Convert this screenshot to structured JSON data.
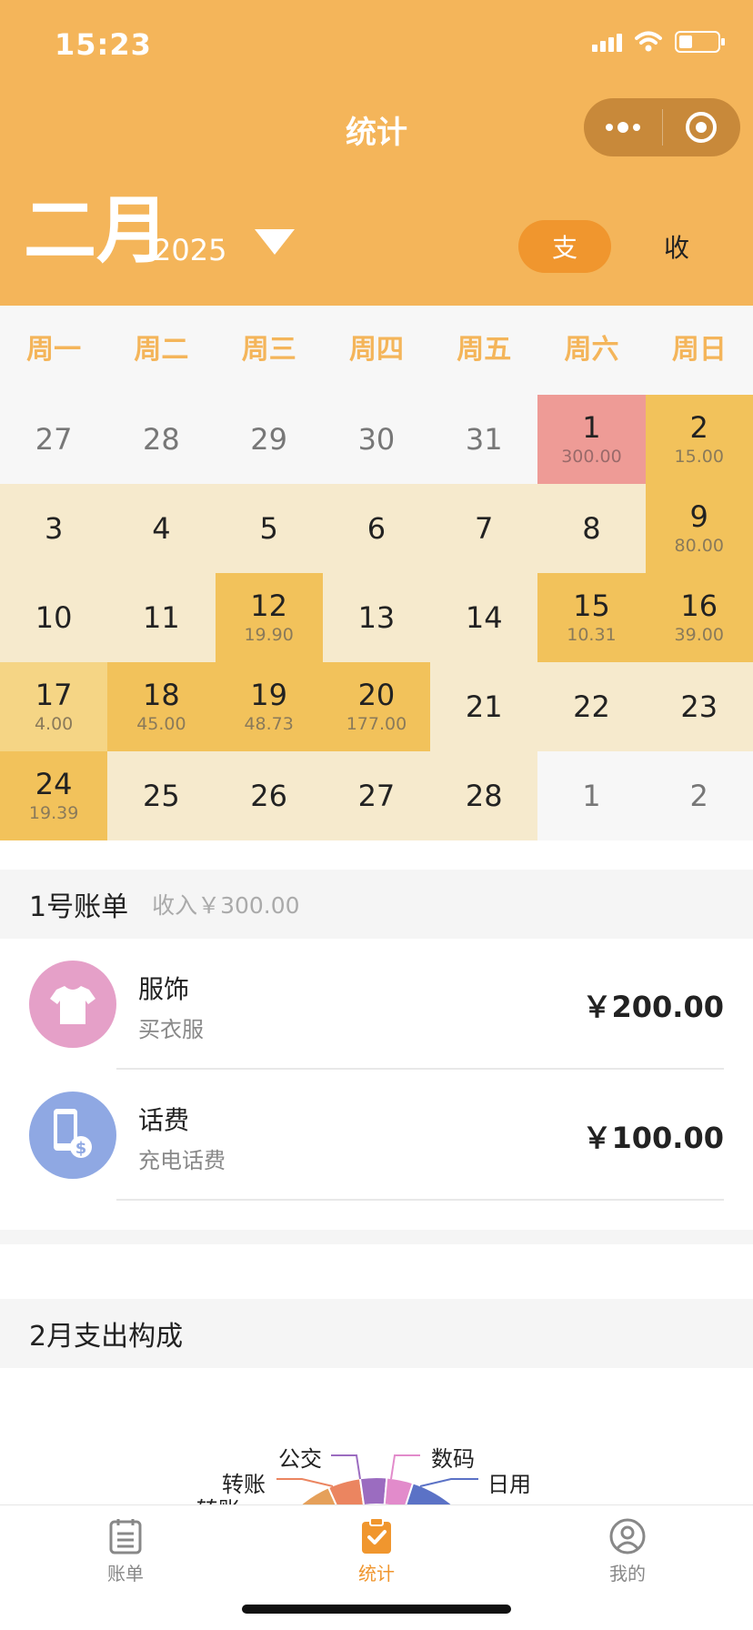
{
  "status": {
    "time": "15:23"
  },
  "nav": {
    "title": "统计"
  },
  "header": {
    "month": "二月",
    "year": "2025",
    "expense_label": "支",
    "income_label": "收"
  },
  "calendar": {
    "weekdays": [
      "周一",
      "周二",
      "周三",
      "周四",
      "周五",
      "周六",
      "周日"
    ],
    "rows": [
      [
        {
          "day": "27",
          "amount": "",
          "kind": "other"
        },
        {
          "day": "28",
          "amount": "",
          "kind": "other"
        },
        {
          "day": "29",
          "amount": "",
          "kind": "other"
        },
        {
          "day": "30",
          "amount": "",
          "kind": "other"
        },
        {
          "day": "31",
          "amount": "",
          "kind": "other"
        },
        {
          "day": "1",
          "amount": "300.00",
          "kind": "inc"
        },
        {
          "day": "2",
          "amount": "15.00",
          "kind": "exp"
        }
      ],
      [
        {
          "day": "3",
          "amount": "",
          "kind": "normal"
        },
        {
          "day": "4",
          "amount": "",
          "kind": "normal"
        },
        {
          "day": "5",
          "amount": "",
          "kind": "normal"
        },
        {
          "day": "6",
          "amount": "",
          "kind": "normal"
        },
        {
          "day": "7",
          "amount": "",
          "kind": "normal"
        },
        {
          "day": "8",
          "amount": "",
          "kind": "normal"
        },
        {
          "day": "9",
          "amount": "80.00",
          "kind": "exp"
        }
      ],
      [
        {
          "day": "10",
          "amount": "",
          "kind": "normal"
        },
        {
          "day": "11",
          "amount": "",
          "kind": "normal"
        },
        {
          "day": "12",
          "amount": "19.90",
          "kind": "exp"
        },
        {
          "day": "13",
          "amount": "",
          "kind": "normal"
        },
        {
          "day": "14",
          "amount": "",
          "kind": "normal"
        },
        {
          "day": "15",
          "amount": "10.31",
          "kind": "exp"
        },
        {
          "day": "16",
          "amount": "39.00",
          "kind": "exp"
        }
      ],
      [
        {
          "day": "17",
          "amount": "4.00",
          "kind": "light"
        },
        {
          "day": "18",
          "amount": "45.00",
          "kind": "exp"
        },
        {
          "day": "19",
          "amount": "48.73",
          "kind": "exp"
        },
        {
          "day": "20",
          "amount": "177.00",
          "kind": "exp"
        },
        {
          "day": "21",
          "amount": "",
          "kind": "normal"
        },
        {
          "day": "22",
          "amount": "",
          "kind": "normal"
        },
        {
          "day": "23",
          "amount": "",
          "kind": "normal"
        }
      ],
      [
        {
          "day": "24",
          "amount": "19.39",
          "kind": "exp"
        },
        {
          "day": "25",
          "amount": "",
          "kind": "normal"
        },
        {
          "day": "26",
          "amount": "",
          "kind": "normal"
        },
        {
          "day": "27",
          "amount": "",
          "kind": "normal"
        },
        {
          "day": "28",
          "amount": "",
          "kind": "normal"
        },
        {
          "day": "1",
          "amount": "",
          "kind": "other"
        },
        {
          "day": "2",
          "amount": "",
          "kind": "other"
        }
      ]
    ]
  },
  "bill": {
    "title": "1号账单",
    "income": "收入￥300.00",
    "items": [
      {
        "name": "服饰",
        "note": "买衣服",
        "amount": "￥200.00",
        "icon": "tshirt-icon",
        "color": "#E5A0C8"
      },
      {
        "name": "话费",
        "note": "充电话费",
        "amount": "￥100.00",
        "icon": "phone-bill-icon",
        "color": "#8FA8E3"
      }
    ]
  },
  "composition": {
    "title": "2月支出构成"
  },
  "chart_data": {
    "type": "pie",
    "labels": [
      "公交",
      "数码",
      "转账",
      "日用",
      "转账"
    ],
    "colors": [
      "#9B6CC0",
      "#E28BCB",
      "#EB8560",
      "#5B72C6",
      "#E5A05A"
    ]
  },
  "tabs": [
    {
      "label": "账单",
      "icon": "bill-list-icon",
      "active": false
    },
    {
      "label": "统计",
      "icon": "stats-clipboard-icon",
      "active": true
    },
    {
      "label": "我的",
      "icon": "profile-icon",
      "active": false
    }
  ],
  "colors": {
    "header": "#F4B55A",
    "accent": "#F0962E",
    "expense_day": "#F2C25B",
    "income_day": "#EE9B96",
    "normal_day": "#F6EACD"
  }
}
